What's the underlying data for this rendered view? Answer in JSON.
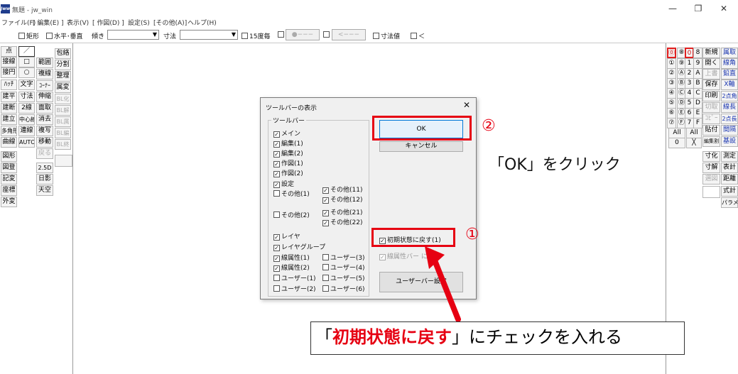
{
  "window": {
    "title": "無題 - jw_win",
    "icon_label": "Jww",
    "minimize": "—",
    "restore": "❐",
    "close": "✕"
  },
  "menu": [
    "ファイル(F)",
    "[ 編集(E) ]",
    "表示(V)",
    "[ 作図(D) ]",
    "設定(S)",
    "[その他(A)]",
    "ヘルプ(H)"
  ],
  "options": {
    "rect": "矩形",
    "horiz_vert": "水平･垂直",
    "tilt": "傾き",
    "dimension": "寸法",
    "every15": "15度毎",
    "arrow1": "●−−−",
    "arrow2": "<−−−",
    "dim_value": "寸法値",
    "lt": "＜"
  },
  "left_toolbar": {
    "col1": [
      "点",
      "接線",
      "接円",
      "ﾊｯﾁ",
      "建平",
      "建断",
      "建立",
      "多角形",
      "曲線"
    ],
    "col1b": [
      "図形",
      "図登",
      "記変",
      "座標",
      "外変"
    ],
    "col2": [
      "／",
      "□",
      "○",
      "文字",
      "寸法",
      "2線",
      "中心線",
      "連線",
      "AUTO"
    ],
    "col3": [
      "範囲",
      "複線",
      "ｺｰﾅｰ",
      "伸縮",
      "面取",
      "消去",
      "複写",
      "移動",
      "戻る"
    ],
    "col3b": [
      "2.5D",
      "日影",
      "天空"
    ],
    "col4": [
      "包絡",
      "分割",
      "整理",
      "属変",
      "BL化",
      "BL解",
      "BL属",
      "BL編",
      "BL終"
    ]
  },
  "right_toolbar": {
    "layer_a": [
      "⓪",
      "①",
      "②",
      "③",
      "④",
      "⑤",
      "⑥",
      "⑦"
    ],
    "layer_b": [
      "⑧",
      "⑨",
      "Ⓐ",
      "Ⓑ",
      "Ⓒ",
      "Ⓓ",
      "Ⓔ",
      "Ⓕ"
    ],
    "layer_c": [
      "0",
      "1",
      "2",
      "3",
      "4",
      "5",
      "6",
      "7"
    ],
    "layer_d": [
      "8",
      "9",
      "A",
      "B",
      "C",
      "D",
      "E",
      "F"
    ],
    "all": "All",
    "zero": "0",
    "cross": "╳",
    "col5": [
      "新規",
      "開く",
      "上書",
      "保存",
      "印刷",
      "切取",
      "ｺﾋﾟｰ",
      "貼付",
      "編集割"
    ],
    "col5b": [
      "寸化",
      "寸解",
      "選図"
    ],
    "col6": [
      "属取",
      "線角",
      "鉛直",
      "X軸",
      "2点角",
      "線長",
      "2点長",
      "間隔",
      "基設"
    ],
    "col6b": [
      "測定",
      "表計",
      "距離",
      "式計",
      "パラメ"
    ]
  },
  "dialog": {
    "title": "ツールバーの表示",
    "close": "✕",
    "group_label": "ツールバー",
    "left_items": [
      {
        "label": "メイン",
        "checked": "✓"
      },
      {
        "label": "編集(1)",
        "checked": "✓"
      },
      {
        "label": "編集(2)",
        "checked": "✓"
      },
      {
        "label": "作図(1)",
        "checked": "✓"
      },
      {
        "label": "作図(2)",
        "checked": "✓"
      },
      {
        "label": "設定",
        "checked": "✓"
      },
      {
        "label": "その他(1)",
        "checked": ""
      },
      {
        "label": "その他(2)",
        "checked": ""
      },
      {
        "label": "レイヤ",
        "checked": "✓"
      },
      {
        "label": "レイヤグループ",
        "checked": "✓"
      },
      {
        "label": "線属性(1)",
        "checked": "✓"
      },
      {
        "label": "線属性(2)",
        "checked": "✓"
      },
      {
        "label": "ユーザー(1)",
        "checked": ""
      },
      {
        "label": "ユーザー(2)",
        "checked": ""
      }
    ],
    "right_items": [
      {
        "label": "その他(11)",
        "checked": "✓"
      },
      {
        "label": "その他(12)",
        "checked": "✓"
      },
      {
        "label": "その他(21)",
        "checked": "✓"
      },
      {
        "label": "その他(22)",
        "checked": "✓"
      },
      {
        "label": "ユーザー(3)",
        "checked": ""
      },
      {
        "label": "ユーザー(4)",
        "checked": ""
      },
      {
        "label": "ユーザー(5)",
        "checked": ""
      },
      {
        "label": "ユーザー(6)",
        "checked": ""
      }
    ],
    "ok": "OK",
    "cancel": "キャンセル",
    "reset_label": "初期状態に戻す(1)",
    "reset_checked": "✓",
    "linebar_label": "線属性バー  に配置",
    "linebar_checked": "✓",
    "userbar": "ユーザーバー設定"
  },
  "annotations": {
    "num1": "①",
    "num2": "②",
    "ok_hint": "「OK」をクリック",
    "callout_pre": "「",
    "callout_red": "初期状態に戻す",
    "callout_post": "」にチェックを入れる",
    "accent": "#e60012"
  }
}
